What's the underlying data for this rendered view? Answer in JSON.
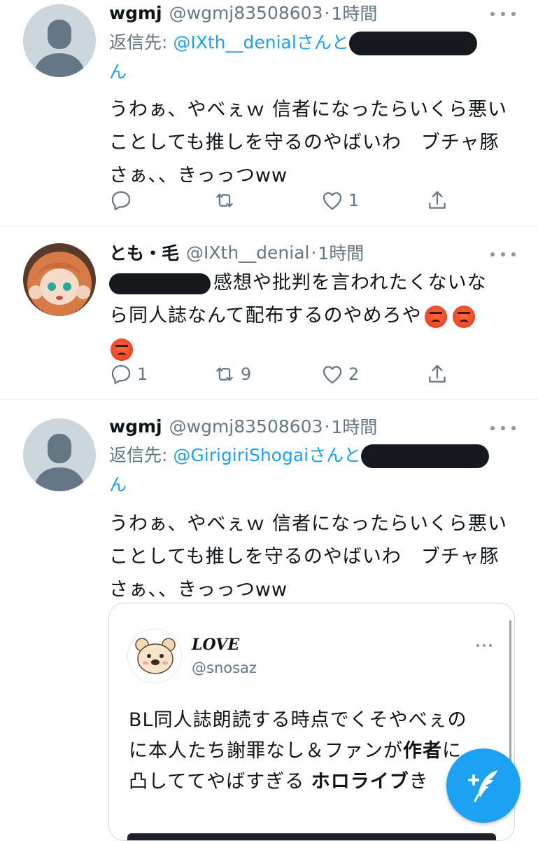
{
  "tweets": [
    {
      "name": "wgmj",
      "handle": "@wgmj83508603",
      "dot": "·",
      "time": "1時間",
      "reply_prefix": "返信先: ",
      "reply_mention": "@IXth__denialさんと",
      "reply_suffix": "ん",
      "text_lines": [
        "うわぁ、やべぇｗ 信者になったらいくら悪い",
        "ことしても推しを守るのやばいわ　ブチャ豚",
        "さぁ、、きっっつww"
      ],
      "actions": {
        "reply": "",
        "retweet": "",
        "like": "1",
        "share": ""
      }
    },
    {
      "name": "とも・毛",
      "handle": "@IXth__denial",
      "dot": "·",
      "time": "1時間",
      "text_lines": [
        "感想や批判を言われたくないな",
        "ら同人誌なんて配布するのやめろや"
      ],
      "actions": {
        "reply": "1",
        "retweet": "9",
        "like": "2",
        "share": ""
      }
    },
    {
      "name": "wgmj",
      "handle": "@wgmj83508603",
      "dot": "·",
      "time": "1時間",
      "reply_prefix": "返信先: ",
      "reply_mention": "@GirigiriShogaiさんと",
      "reply_suffix": "ん",
      "text_lines": [
        "うわぁ、やべぇｗ 信者になったらいくら悪い",
        "ことしても推しを守るのやばいわ　ブチャ豚",
        "さぁ、、きっっつww"
      ],
      "quote": {
        "name": "LOVE",
        "handle": "@snosaz",
        "line1": "BL同人誌朗読する時点でくそやべぇの",
        "line2_a": "に本人たち謝罪なし＆ファンが",
        "line2_b": "作者",
        "line2_c": "に",
        "line3_a": "凸しててやばすぎる ",
        "line3_b": "ホロライブ",
        "line3_c": "き"
      }
    }
  ],
  "colors": {
    "accent": "#1da1f2",
    "secondary_text": "#657786",
    "divider": "#e6ecf0"
  },
  "icons": {
    "reply": "reply-icon",
    "retweet": "retweet-icon",
    "like": "heart-icon",
    "share": "share-icon",
    "compose": "compose-tweet-icon"
  }
}
